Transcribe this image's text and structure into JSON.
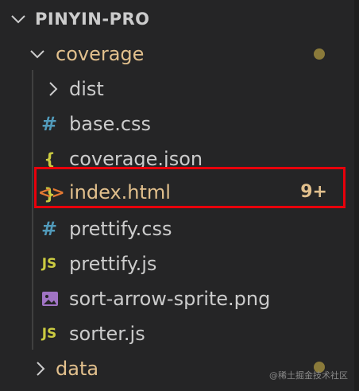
{
  "explorer": {
    "section_title": "PINYIN-PRO",
    "folder": {
      "name": "coverage",
      "status": "modified-dot"
    },
    "items": [
      {
        "name": "dist",
        "type": "folder",
        "icon": "chevron-right-icon"
      },
      {
        "name": "base.css",
        "type": "file",
        "icon": "css-icon",
        "glyph": "#"
      },
      {
        "name": "coverage.json",
        "type": "file",
        "icon": "json-icon",
        "glyph": "{ }"
      },
      {
        "name": "index.html",
        "type": "file",
        "icon": "html-icon",
        "glyph": "<>",
        "badge": "9+",
        "highlighted": true
      },
      {
        "name": "prettify.css",
        "type": "file",
        "icon": "css-icon",
        "glyph": "#"
      },
      {
        "name": "prettify.js",
        "type": "file",
        "icon": "js-icon",
        "glyph": "JS"
      },
      {
        "name": "sort-arrow-sprite.png",
        "type": "file",
        "icon": "image-icon"
      },
      {
        "name": "sorter.js",
        "type": "file",
        "icon": "js-icon",
        "glyph": "JS"
      }
    ],
    "bottom_folder": {
      "name": "data",
      "status": "modified-dot"
    },
    "watermark": "@稀土掘金技术社区"
  },
  "colors": {
    "background": "#252526",
    "modified_text": "#e2c08d",
    "highlight_border": "#e8000b",
    "css_icon": "#519aba",
    "js_icon": "#cbcb41",
    "html_icon": "#e37933"
  }
}
